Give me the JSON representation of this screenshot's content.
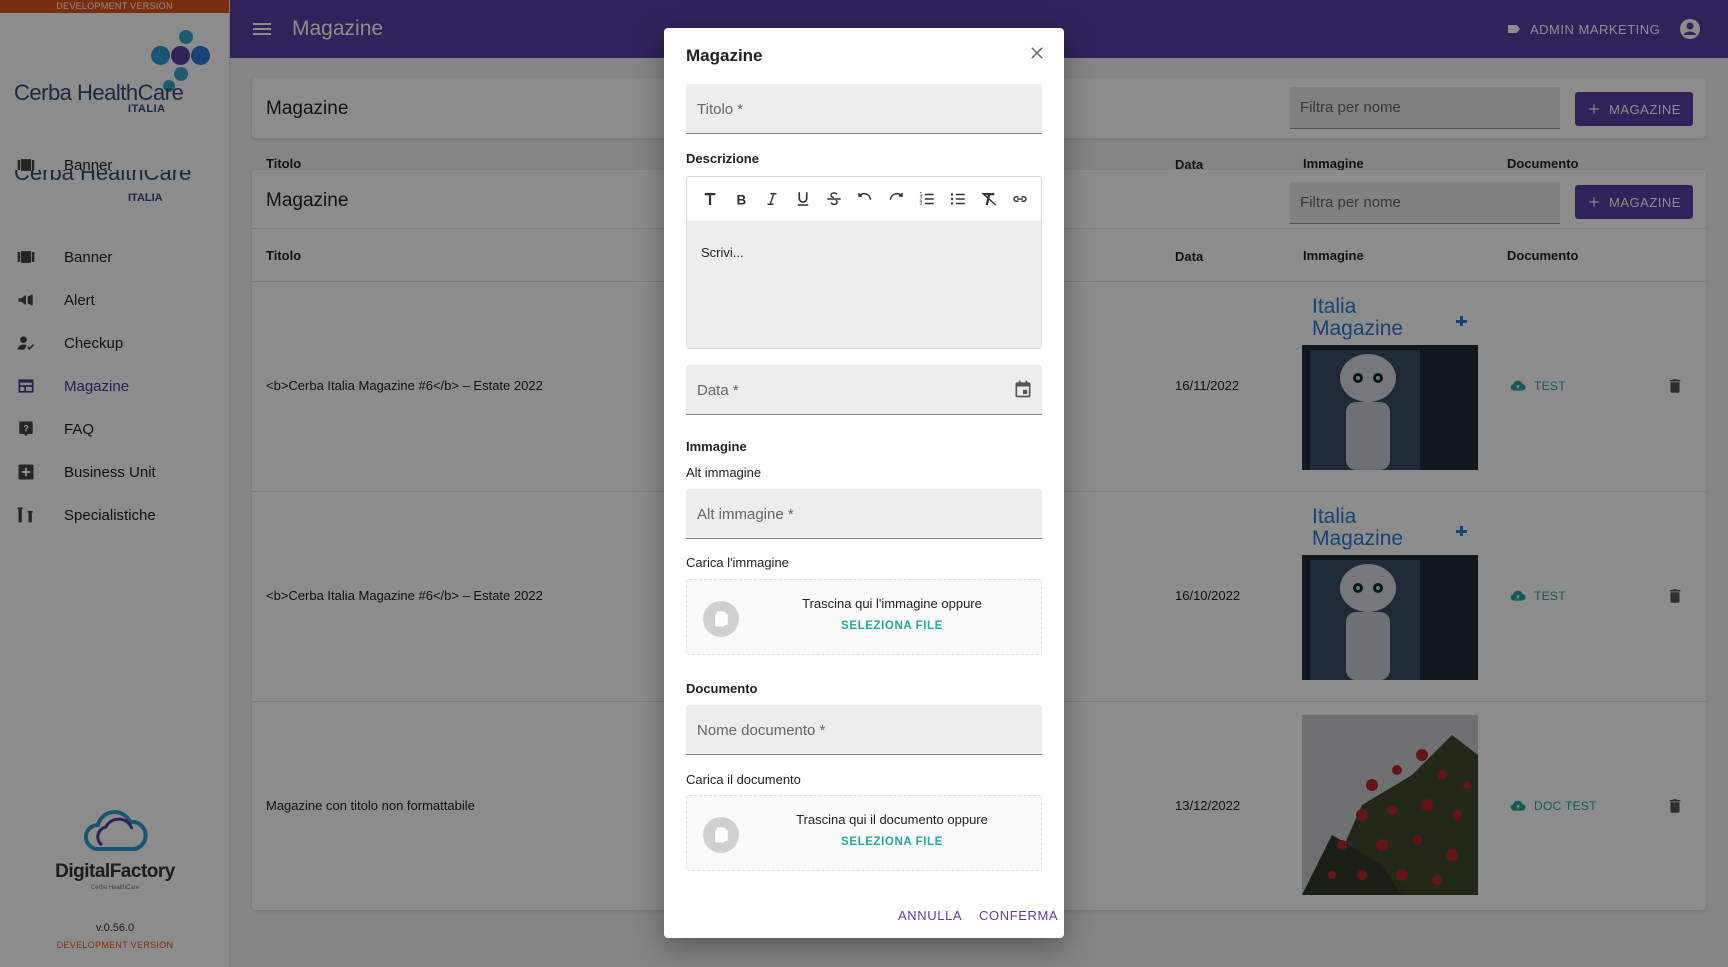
{
  "dev_banner": "DEVELOPMENT VERSION",
  "logo": {
    "brand": "Cerba HealthCare",
    "sub": "ITALIA"
  },
  "sidebar": {
    "ghost_item": "Banner",
    "items": [
      {
        "label": "Banner",
        "icon": "ticket-icon"
      },
      {
        "label": "Alert",
        "icon": "megaphone-icon"
      },
      {
        "label": "Checkup",
        "icon": "person-check-icon"
      },
      {
        "label": "Magazine",
        "icon": "web-layout-icon",
        "active": true
      },
      {
        "label": "FAQ",
        "icon": "help-box-icon"
      },
      {
        "label": "Business Unit",
        "icon": "plus-box-icon"
      },
      {
        "label": "Specialistiche",
        "icon": "lab-icon"
      }
    ],
    "footer_logo": {
      "title": "DigitalFactory",
      "sub": "Cerba HealthCare"
    },
    "version": "v.0.56.0",
    "dev_label": "DEVELOPMENT VERSION"
  },
  "topbar": {
    "title": "Magazine",
    "user": "ADMIN MARKETING"
  },
  "page": {
    "title": "Magazine",
    "filter_placeholder": "Filtra per nome",
    "add_button": "MAGAZINE",
    "columns": {
      "title": "Titolo",
      "date": "Data",
      "image": "Immagine",
      "document": "Documento"
    },
    "rows": [
      {
        "title": "<b>Cerba Italia Magazine #6</b> – Estate 2022",
        "date": "16/11/2022",
        "doc": "TEST",
        "image_type": "cover"
      },
      {
        "title": "<b>Cerba Italia Magazine #6</b> – Estate 2022",
        "date": "16/10/2022",
        "doc": "TEST",
        "image_type": "cover"
      },
      {
        "title": "Magazine con titolo non formattabile",
        "date": "13/12/2022",
        "doc": "DOC TEST",
        "image_type": "roses"
      }
    ],
    "cover": {
      "line1": "Italia",
      "line2": "Magazine"
    }
  },
  "dialog": {
    "title": "Magazine",
    "titolo_placeholder": "Titolo *",
    "descrizione_label": "Descrizione",
    "editor_placeholder": "Scrivi...",
    "data_placeholder": "Data *",
    "immagine_label": "Immagine",
    "alt_label": "Alt immagine",
    "alt_placeholder": "Alt immagine *",
    "carica_immagine_label": "Carica l'immagine",
    "drop_image_text": "Trascina qui l'immagine oppure",
    "select_file": "SELEZIONA FILE",
    "documento_label": "Documento",
    "nome_doc_placeholder": "Nome documento *",
    "carica_doc_label": "Carica il documento",
    "drop_doc_text": "Trascina qui il documento oppure",
    "cancel": "ANNULLA",
    "confirm": "CONFERMA"
  },
  "colors": {
    "primary": "#5a3fa4",
    "accent": "#26a69a",
    "dev": "#e0531c"
  }
}
